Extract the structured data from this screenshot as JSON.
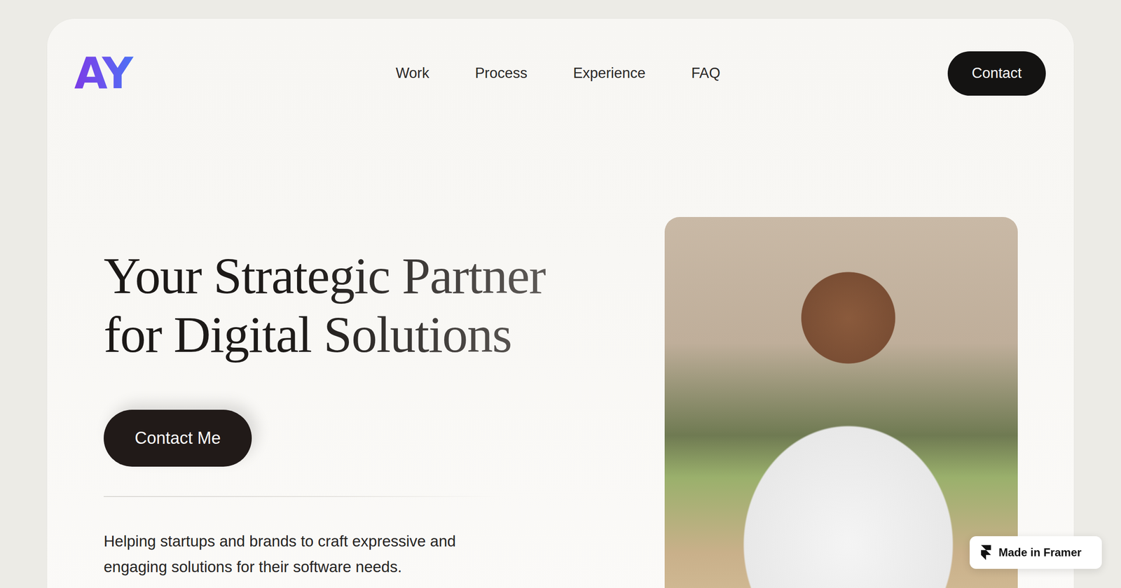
{
  "logo": {
    "text": "AY"
  },
  "nav": {
    "items": [
      {
        "label": "Work"
      },
      {
        "label": "Process"
      },
      {
        "label": "Experience"
      },
      {
        "label": "FAQ"
      }
    ]
  },
  "contact_button": "Contact",
  "hero": {
    "headline": [
      "Your Strategic Partner",
      "for Digital Solutions"
    ],
    "cta": "Contact Me",
    "description": [
      "Helping startups and brands to craft expressive and",
      "engaging solutions for their software needs."
    ]
  },
  "badge": {
    "label": "Made in Framer"
  }
}
